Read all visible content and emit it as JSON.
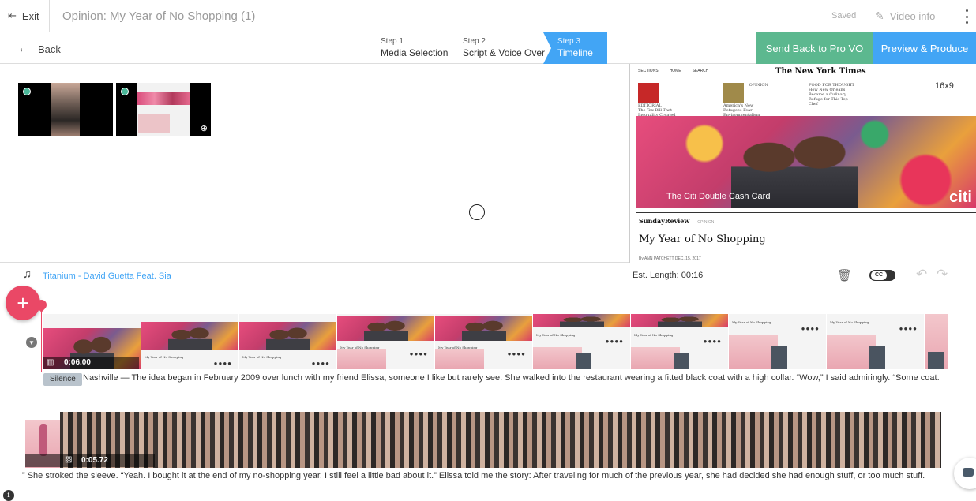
{
  "topbar": {
    "exit_label": "Exit",
    "title": "Opinion: My Year of No Shopping (1)",
    "saved_label": "Saved",
    "video_info_label": "Video info"
  },
  "stepbar": {
    "back_label": "Back",
    "steps": [
      {
        "number": "Step 1",
        "label": "Media Selection"
      },
      {
        "number": "Step 2",
        "label": "Script & Voice Over"
      },
      {
        "number": "Step 3",
        "label": "Timeline"
      }
    ],
    "send_back_label": "Send Back to Pro VO",
    "preview_label": "Preview & Produce"
  },
  "preview": {
    "nav": [
      "SECTIONS",
      "HOME",
      "SEARCH"
    ],
    "logo": "The New York Times",
    "ratio": "16x9",
    "teasers": [
      {
        "kicker": "EDITORIAL",
        "text": "The Tax Bill That Inequality Created"
      },
      {
        "kicker": "OPINION",
        "text": "America's New Refugees Fear Environmentalism"
      },
      {
        "kicker": "FOOD FOR THOUGHT",
        "text": "How New Orleans Became a Culinary Refuge for This Top Chef"
      }
    ],
    "hero_caption": "The Citi Double Cash Card",
    "hero_logo": "citi",
    "section": "SundayReview",
    "section_tag": "OPINION",
    "headline": "My Year of No Shopping",
    "byline": "By ANN PATCHETT   DEC. 15, 2017"
  },
  "audio": {
    "track": "Titanium - David Guetta Feat. Sia",
    "est_length": "Est. Length: 00:16",
    "cc_label": "CC"
  },
  "clip1": {
    "duration": "0:06.00",
    "silence_label": "Silence",
    "script": "Nashville — The idea began in February 2009 over lunch with my friend Elissa, someone I like but rarely see. She walked into the restaurant wearing a fitted black coat with a high collar. “Wow,” I said admiringly. “Some coat."
  },
  "clip2": {
    "duration": "0:05.72",
    "script": "” She stroked the sleeve. “Yeah. I bought it at the end of my no-shopping year. I still feel a little bad about it.” Elissa told me the story: After traveling for much of the previous year, she had decided she had enough stuff, or too much stuff."
  },
  "frame_texts": {
    "headline_small": "My Year of No Shopping",
    "section_small": "SundayReview",
    "dots": "●●●●"
  }
}
